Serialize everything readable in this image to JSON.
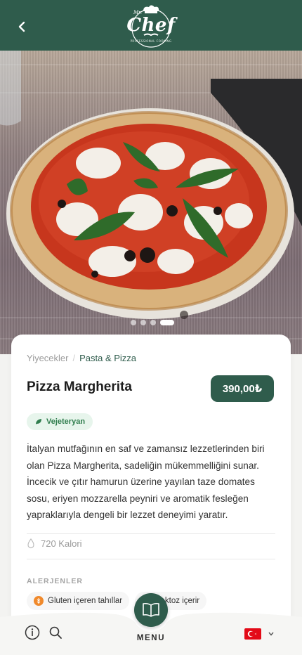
{
  "header": {
    "logo_text": "Chef",
    "logo_top": "Mr.",
    "logo_sub": "PROFESSIONAL COOKING"
  },
  "hero": {
    "slides_count": 4,
    "active_slide": 4
  },
  "breadcrumb": {
    "parent": "Yiyecekler",
    "separator": "/",
    "current": "Pasta & Pizza"
  },
  "product": {
    "title": "Pizza Margherita",
    "price": "390,00₺",
    "tag": "Vejeteryan",
    "description": "İtalyan mutfağının en saf ve zamansız lezzetlerinden biri olan Pizza Margherita, sadeliğin mükemmelliğini sunar. İncecik ve çıtır hamurun üzerine yayılan taze domates sosu, eriyen mozzarella peyniri ve aromatik fesleğen yapraklarıyla dengeli bir lezzet deneyimi yaratır.",
    "calories": "720 Kalori"
  },
  "allergens": {
    "heading": "ALERJENLER",
    "items": [
      {
        "label": "Gluten içeren tahıllar",
        "icon": "grain-icon",
        "color": "#f0892b"
      },
      {
        "label": "Laktoz içerir",
        "icon": "milk-icon",
        "color": "#3a8fd9"
      }
    ]
  },
  "bottom_nav": {
    "menu_label": "MENU",
    "language_icon": "turkey-flag-icon"
  },
  "colors": {
    "brand": "#2f5c4c",
    "tag_bg": "#e7f5ec",
    "tag_text": "#2f7d4d"
  }
}
